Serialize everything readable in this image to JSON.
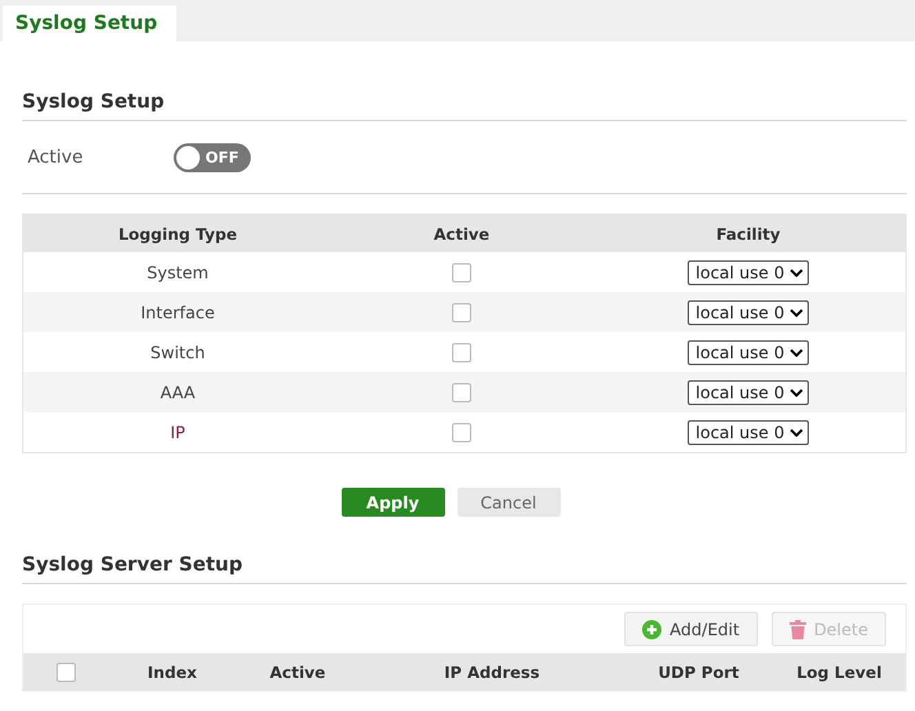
{
  "tabs": [
    {
      "label": "Syslog Setup",
      "selected": true
    }
  ],
  "syslog_setup": {
    "title": "Syslog Setup",
    "active_label": "Active",
    "active_toggle": {
      "on": false,
      "label": "OFF"
    },
    "table": {
      "columns": [
        "Logging Type",
        "Active",
        "Facility"
      ],
      "rows": [
        {
          "type": "System",
          "link": false,
          "active": false,
          "facility": "local use 0"
        },
        {
          "type": "Interface",
          "link": false,
          "active": false,
          "facility": "local use 0"
        },
        {
          "type": "Switch",
          "link": false,
          "active": false,
          "facility": "local use 0"
        },
        {
          "type": "AAA",
          "link": false,
          "active": false,
          "facility": "local use 0"
        },
        {
          "type": "IP",
          "link": true,
          "active": false,
          "facility": "local use 0"
        }
      ]
    },
    "buttons": [
      {
        "label": "Apply",
        "kind": "primary"
      },
      {
        "label": "Cancel",
        "kind": "secondary"
      }
    ]
  },
  "syslog_server_setup": {
    "title": "Syslog Server Setup",
    "toolbar": [
      {
        "label": "Add/Edit",
        "kind": "add",
        "disabled": false
      },
      {
        "label": "Delete",
        "kind": "delete",
        "disabled": true
      }
    ],
    "select_all": {
      "checked": false
    },
    "columns": [
      "Index",
      "Active",
      "IP Address",
      "UDP Port",
      "Log Level"
    ]
  }
}
